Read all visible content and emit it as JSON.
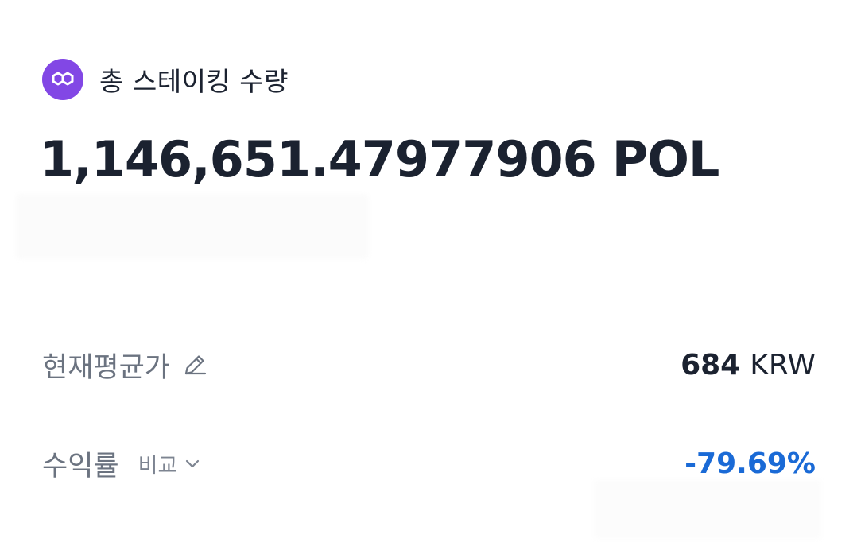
{
  "header": {
    "title": "총 스테이킹 수량",
    "logo_icon": "polygon-logo-icon",
    "logo_color": "#8247e5"
  },
  "total_staking": {
    "amount": "1,146,651.47977906",
    "unit": "POL"
  },
  "average_price": {
    "label": "현재평균가",
    "edit_icon": "pencil-icon",
    "value": "684",
    "unit": "KRW"
  },
  "return_rate": {
    "label": "수익률",
    "compare_label": "비교",
    "compare_icon": "chevron-down-icon",
    "value": "-79.69%",
    "color": "#1a6ad6"
  }
}
